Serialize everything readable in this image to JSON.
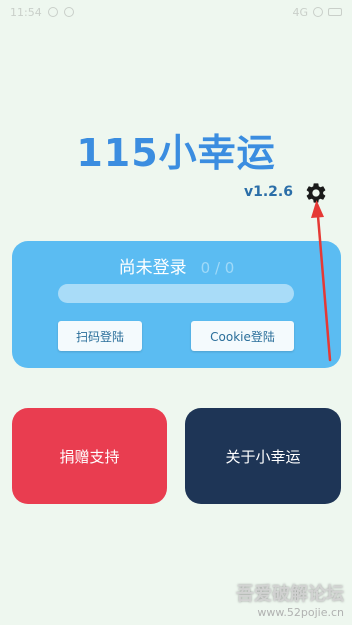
{
  "status_bar": {
    "time": "11:54",
    "network": "4G"
  },
  "app": {
    "title": "115小幸运",
    "version": "v1.2.6",
    "settings_icon": "gear-icon"
  },
  "login_card": {
    "status_text": "尚未登录",
    "count_text": "0 / 0",
    "progress": 0,
    "qr_login_label": "扫码登陆",
    "cookie_login_label": "Cookie登陆",
    "color": "#5bbcf2"
  },
  "actions": {
    "donate_label": "捐赠支持",
    "about_label": "关于小幸运",
    "donate_color": "#e93d50",
    "about_color": "#1e3556"
  },
  "watermark": {
    "title": "吾爱破解论坛",
    "url": "www.52pojie.cn"
  },
  "colors": {
    "background": "#eef7ef",
    "accent": "#3b8de0",
    "annotation_arrow": "#e53935"
  }
}
